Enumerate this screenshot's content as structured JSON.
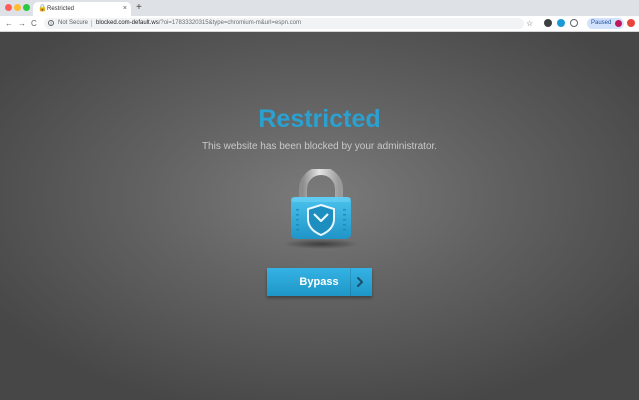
{
  "browser": {
    "tab": {
      "title": "Restricted",
      "close_glyph": "×",
      "favicon": "lock-icon"
    },
    "new_tab_glyph": "+",
    "toolbar": {
      "back_glyph": "←",
      "forward_glyph": "→",
      "reload_glyph": "C",
      "info_glyph": "i",
      "security_label": "Not Secure",
      "url_host": "blocked.com-default.ws",
      "url_path": "/?oi=17833320315&type=chromium-m&url=espn.com",
      "bookmark_glyph": "☆",
      "paused_label": "Paused"
    },
    "extensions": [
      "dark-circle-icon",
      "blue-circle-icon",
      "outline-circle-icon"
    ],
    "colors": {
      "accent": "#2aa1d0",
      "background": "#5a5a5a"
    }
  },
  "page": {
    "headline": "Restricted",
    "message": "This website has been blocked by your administrator.",
    "icon": "padlock-shield-icon",
    "bypass_button": {
      "label": "Bypass",
      "icon": "chevron-right-icon"
    }
  }
}
